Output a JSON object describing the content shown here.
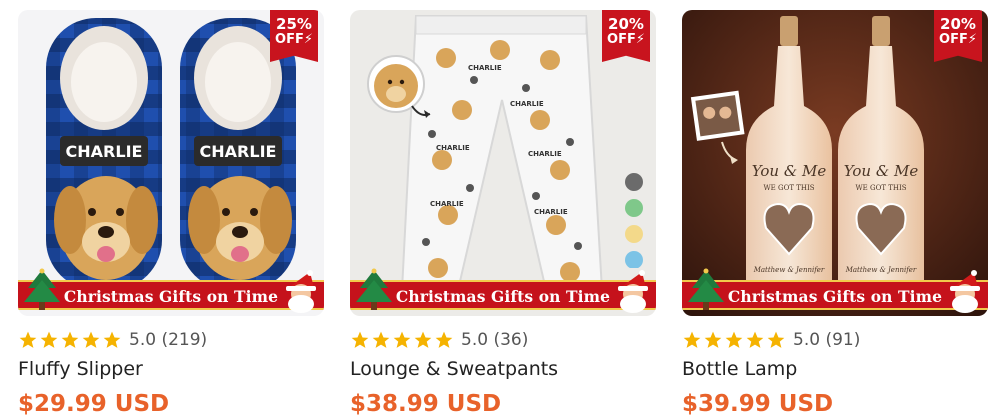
{
  "products": [
    {
      "name": "Fluffy Slipper",
      "rating": "5.0",
      "reviews": "(219)",
      "price": "$29.99 USD",
      "discount": "25%",
      "off_label": "OFF⚡",
      "banner": "Christmas Gifts on Time",
      "personalization_text": "CHARLIE"
    },
    {
      "name": "Lounge & Sweatpants",
      "rating": "5.0",
      "reviews": "(36)",
      "price": "$38.99 USD",
      "discount": "20%",
      "off_label": "OFF⚡",
      "banner": "Christmas Gifts on Time",
      "personalization_text": "CHARLIE",
      "color_swatches": [
        "#6b6b6b",
        "#7fc88a",
        "#f3d98a",
        "#7cc3e6"
      ]
    },
    {
      "name": "Bottle Lamp",
      "rating": "5.0",
      "reviews": "(91)",
      "price": "$39.99 USD",
      "discount": "20%",
      "off_label": "OFF⚡",
      "banner": "Christmas Gifts on Time",
      "bottle_text_1": "You & Me",
      "bottle_text_2": "WE GOT THIS",
      "bottle_names": "Matthew & Jennifer"
    }
  ],
  "colors": {
    "price": "#e8622a",
    "badge": "#c8141e",
    "star": "#f5b301",
    "banner": "#c5121b"
  },
  "icons": [
    "star-icon",
    "christmas-tree-icon",
    "santa-icon"
  ]
}
